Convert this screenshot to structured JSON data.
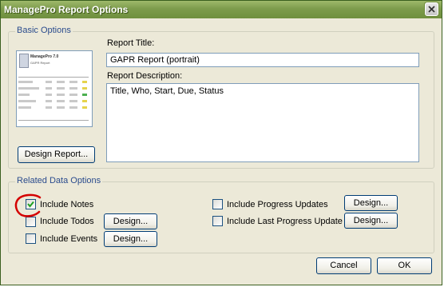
{
  "window": {
    "title": "ManagePro Report Options"
  },
  "basic_options": {
    "legend": "Basic Options",
    "thumbnail": {
      "app_name": "ManagePro 7.0",
      "report_name": "GAPR Report"
    },
    "design_button": "Design Report...",
    "report_title_label": "Report Title:",
    "report_title_value": "GAPR Report (portrait)",
    "report_description_label": "Report Description:",
    "report_description_value": "Title, Who, Start, Due, Status"
  },
  "related_options": {
    "legend": "Related Data Options",
    "include_notes": {
      "label": "Include Notes",
      "checked": true
    },
    "include_todos": {
      "label": "Include Todos",
      "checked": false,
      "design": "Design..."
    },
    "include_events": {
      "label": "Include Events",
      "checked": false,
      "design": "Design..."
    },
    "include_progress_updates": {
      "label": "Include Progress Updates",
      "checked": false,
      "design": "Design..."
    },
    "include_last_progress_update": {
      "label": "Include Last Progress Update",
      "checked": false,
      "design": "Design..."
    }
  },
  "footer": {
    "cancel": "Cancel",
    "ok": "OK"
  },
  "colors": {
    "title_bar": "#7d9c4c",
    "legend_text": "#2a4b8d",
    "annotation_circle": "#d40000",
    "check_mark": "#21a121"
  }
}
